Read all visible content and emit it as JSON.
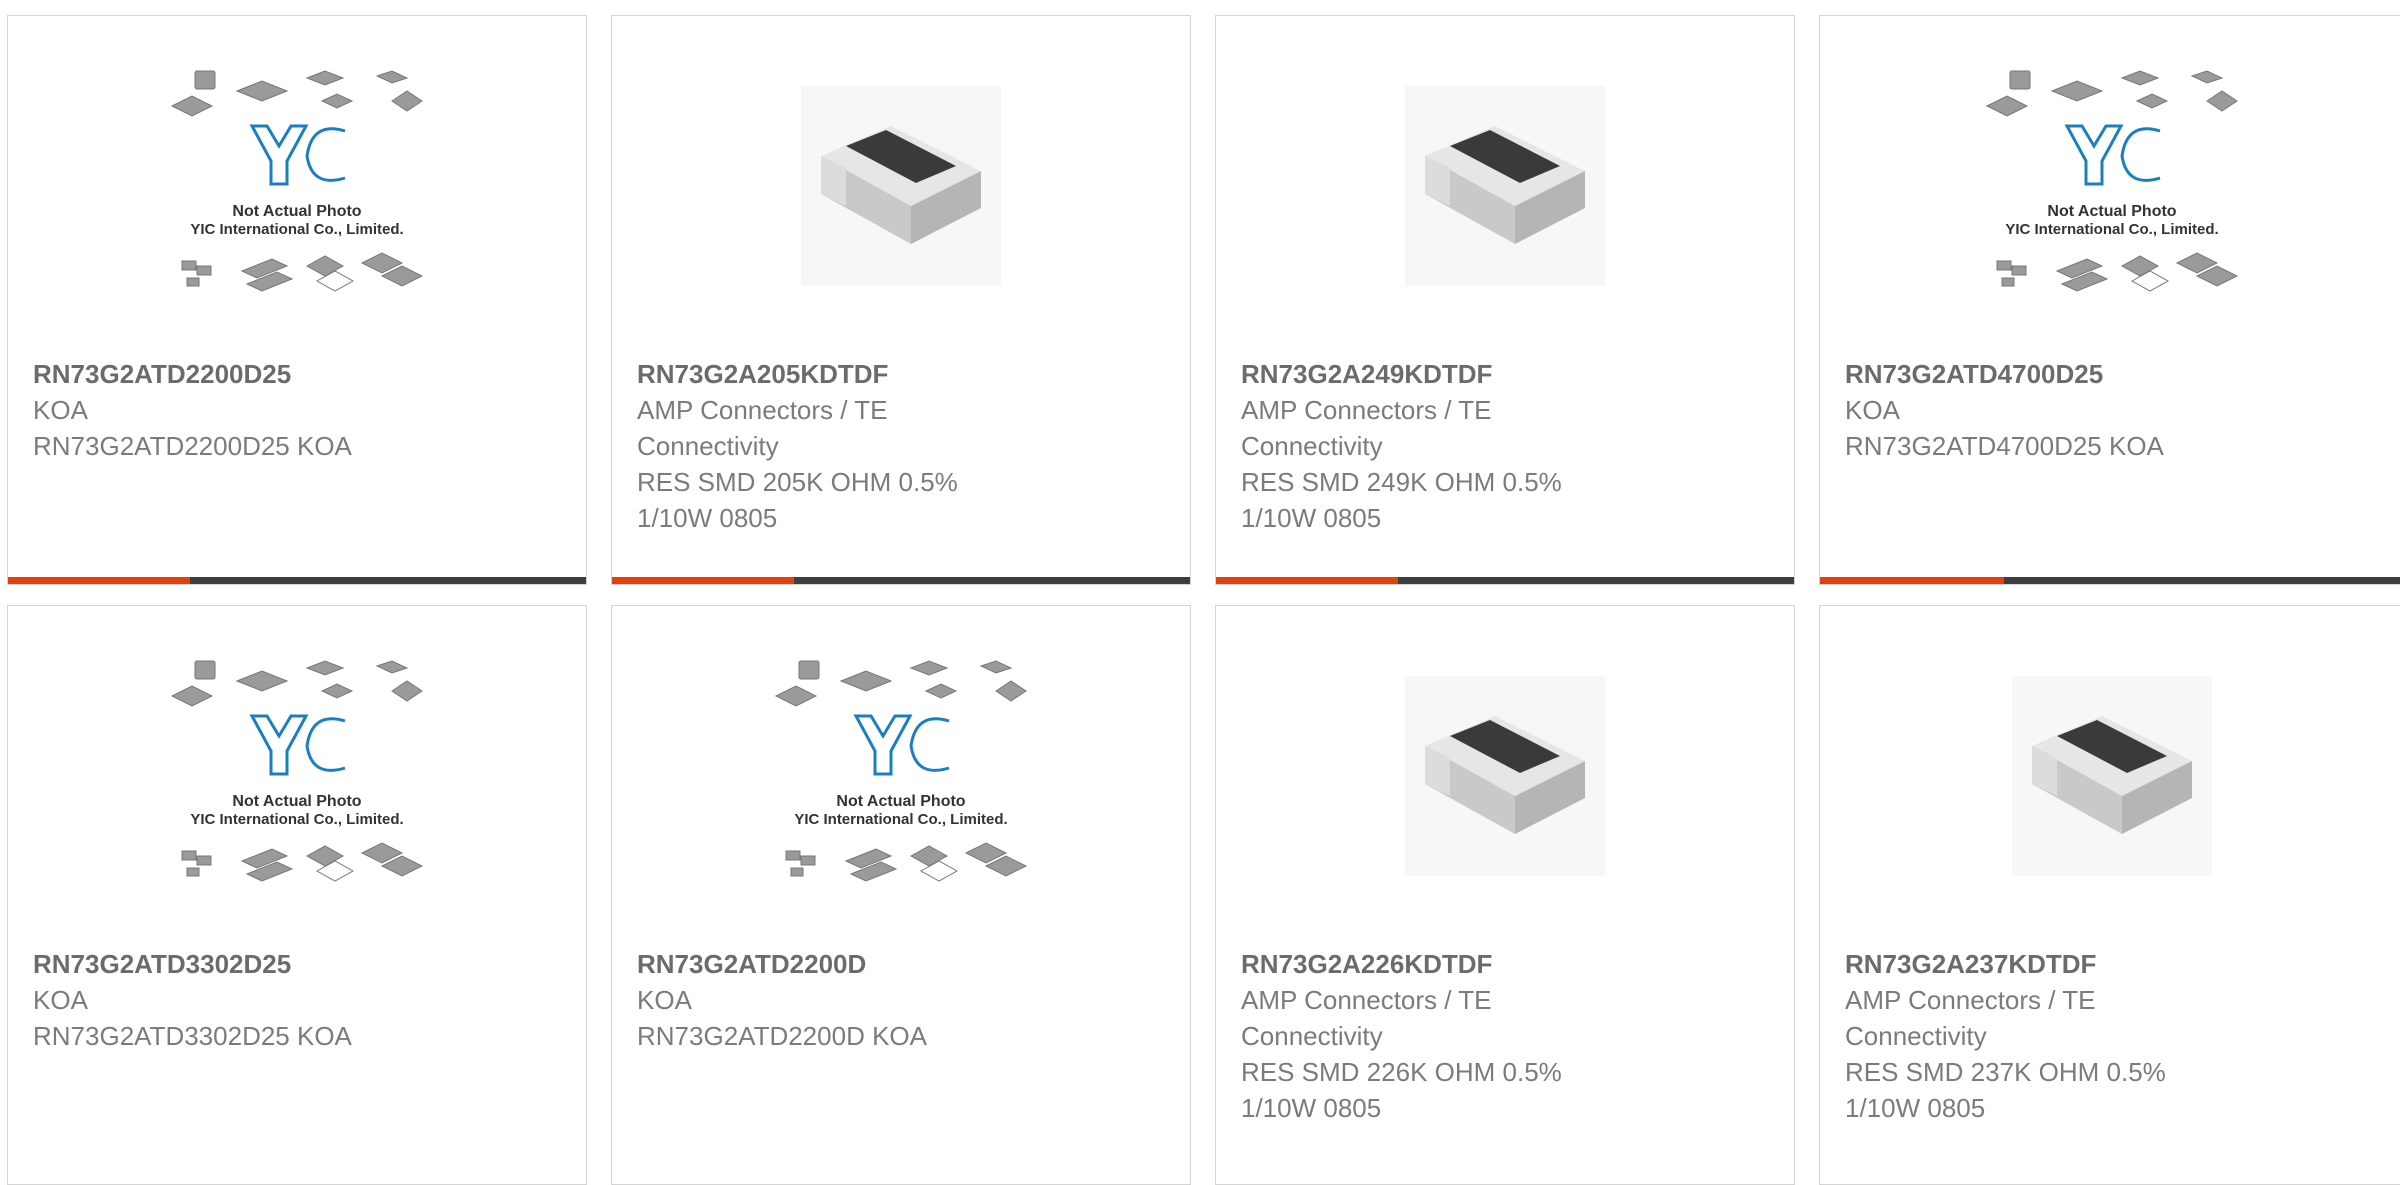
{
  "colors": {
    "accent": "#e2400f",
    "bar_dark": "#3e3e3e",
    "yic_blue": "#1a7fc1",
    "card_border": "#d4d4d4"
  },
  "cards": [
    {
      "part_number": "RN73G2ATD2200D25",
      "manufacturer": "KOA",
      "description": "RN73G2ATD2200D25 KOA",
      "image": "yic-not-actual-photo",
      "image_text_1": "Not Actual Photo",
      "image_text_2": "YIC International Co., Limited.",
      "progress": 0.31,
      "has_bar": true
    },
    {
      "part_number": "RN73G2A205KDTDF",
      "manufacturer": "AMP Connectors / TE Connectivity",
      "description": "RES SMD 205K OHM 0.5% 1/10W 0805",
      "image": "chip-resistor",
      "progress": 0.31,
      "has_bar": true
    },
    {
      "part_number": "RN73G2A249KDTDF",
      "manufacturer": "AMP Connectors / TE Connectivity",
      "description": "RES SMD 249K OHM 0.5% 1/10W 0805",
      "image": "chip-resistor",
      "progress": 0.31,
      "has_bar": true
    },
    {
      "part_number": "RN73G2ATD4700D25",
      "manufacturer": "KOA",
      "description": "RN73G2ATD4700D25 KOA",
      "image": "yic-not-actual-photo",
      "image_text_1": "Not Actual Photo",
      "image_text_2": "YIC International Co., Limited.",
      "progress": 0.31,
      "has_bar": true
    },
    {
      "part_number": "RN73G2ATD3302D25",
      "manufacturer": "KOA",
      "description": "RN73G2ATD3302D25 KOA",
      "image": "yic-not-actual-photo",
      "image_text_1": "Not Actual Photo",
      "image_text_2": "YIC International Co., Limited.",
      "has_bar": false
    },
    {
      "part_number": "RN73G2ATD2200D",
      "manufacturer": "KOA",
      "description": "RN73G2ATD2200D KOA",
      "image": "yic-not-actual-photo",
      "image_text_1": "Not Actual Photo",
      "image_text_2": "YIC International Co., Limited.",
      "has_bar": false
    },
    {
      "part_number": "RN73G2A226KDTDF",
      "manufacturer": "AMP Connectors / TE Connectivity",
      "description": "RES SMD 226K OHM 0.5% 1/10W 0805",
      "image": "chip-resistor",
      "has_bar": false
    },
    {
      "part_number": "RN73G2A237KDTDF",
      "manufacturer": "AMP Connectors / TE Connectivity",
      "description": "RES SMD 237K OHM 0.5% 1/10W 0805",
      "image": "chip-resistor",
      "has_bar": false
    }
  ]
}
